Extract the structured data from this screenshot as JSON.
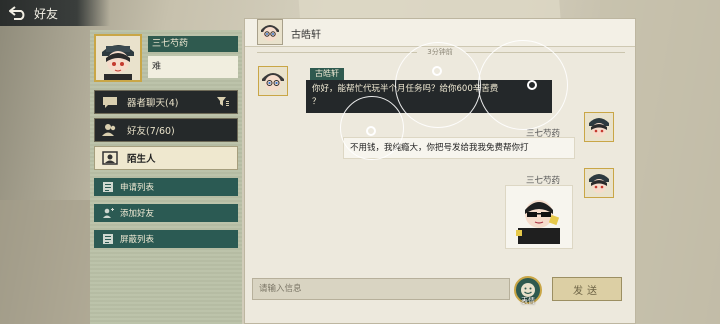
{
  "topbar": {
    "title": "好友"
  },
  "profile": {
    "name": "三七芍药",
    "status": "难"
  },
  "menu": [
    {
      "label": "器者聊天(4)",
      "active": false
    },
    {
      "label": "好友(7/60)",
      "active": false
    },
    {
      "label": "陌生人",
      "active": true
    }
  ],
  "submenu": [
    {
      "label": "申请列表"
    },
    {
      "label": "添加好友"
    },
    {
      "label": "屏蔽列表"
    }
  ],
  "chat": {
    "title": "古皓轩",
    "timestamp": "3分钟前",
    "messages": [
      {
        "sender": "古皓轩",
        "side": "left",
        "text_line1": "你好，能帮忙代玩半个月任务吗？给你600辛苦费",
        "text_line2": "？"
      },
      {
        "sender": "三七芍药",
        "side": "right",
        "text": "不用钱，我纯瘾大，你把号发给我我免费帮你打"
      },
      {
        "sender": "三七芍药",
        "side": "right",
        "type": "sticker"
      }
    ]
  },
  "input": {
    "placeholder": "请输入信息"
  },
  "buttons": {
    "emoji_label": "表情",
    "send_label": "发送"
  },
  "colors": {
    "accent_green": "#2f5a4f",
    "gold_border": "#c9a646",
    "dark": "#24282a"
  }
}
